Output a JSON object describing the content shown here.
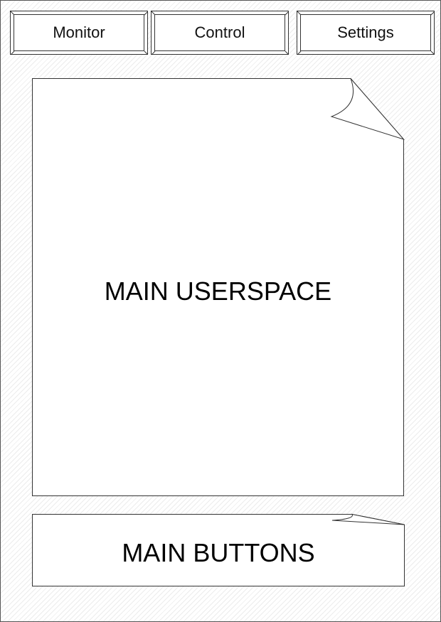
{
  "tabs": [
    {
      "label": "Monitor"
    },
    {
      "label": "Control"
    },
    {
      "label": "Settings"
    }
  ],
  "userspace": {
    "label": "MAIN USERSPACE"
  },
  "buttons_area": {
    "label": "MAIN BUTTONS"
  },
  "colors": {
    "outline": "#333333",
    "background_hatch": "#ececec",
    "panel": "#ffffff"
  }
}
